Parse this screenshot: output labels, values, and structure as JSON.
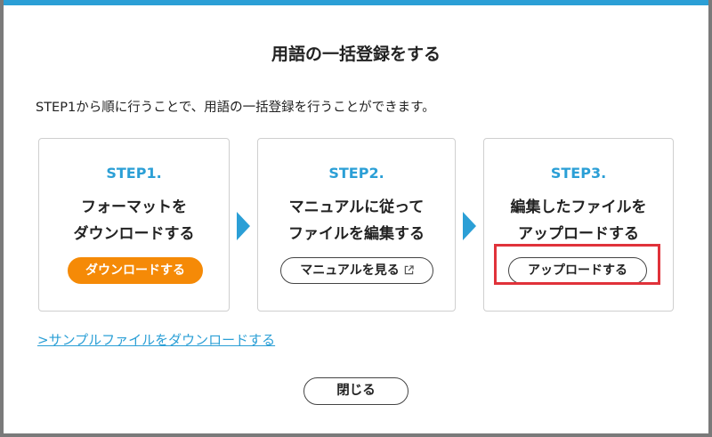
{
  "dialog": {
    "title": "用語の一括登録をする",
    "description": "STEP1から順に行うことで、用語の一括登録を行うことができます。"
  },
  "steps": [
    {
      "step_label": "STEP1.",
      "heading_line1": "フォーマットを",
      "heading_line2": "ダウンロードする",
      "button_label": "ダウンロードする"
    },
    {
      "step_label": "STEP2.",
      "heading_line1": "マニュアルに従って",
      "heading_line2": "ファイルを編集する",
      "button_label": "マニュアルを見る"
    },
    {
      "step_label": "STEP3.",
      "heading_line1": "編集したファイルを",
      "heading_line2": "アップロードする",
      "button_label": "アップロードする"
    }
  ],
  "sample_link": ">サンプルファイルをダウンロードする",
  "close_button": "閉じる",
  "colors": {
    "accent": "#2b9fd6",
    "primary_button": "#f58a07",
    "highlight": "#e0323a"
  },
  "icons": {
    "external_link": "external-link-icon",
    "step_arrow": "arrow-right-icon"
  }
}
